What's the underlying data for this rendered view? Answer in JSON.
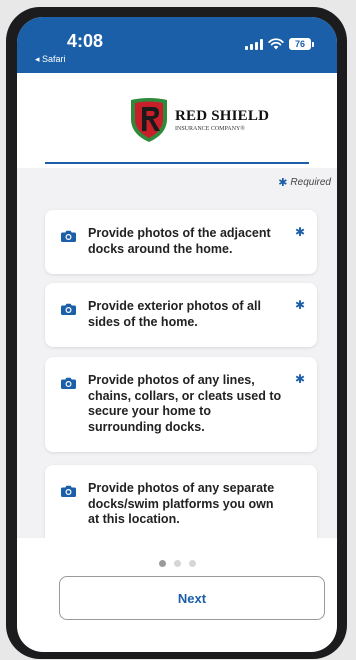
{
  "status_bar": {
    "time": "4:08",
    "back_app": "◂ Safari",
    "battery": "76"
  },
  "logo": {
    "name": "RED SHIELD",
    "subtitle": "INSURANCE COMPANY®",
    "mark_letter": "R"
  },
  "required_label": "Required",
  "cards": [
    {
      "text": "Provide photos of the adjacent docks around the home.",
      "required": true
    },
    {
      "text": "Provide exterior photos of all sides of the home.",
      "required": true
    },
    {
      "text": "Provide photos of any lines, chains, collars, or cleats used to secure your home to surrounding docks.",
      "required": true
    },
    {
      "text": "Provide photos of any separate docks/swim platforms you own at this location.",
      "required": false
    }
  ],
  "pagination": {
    "pages": 3,
    "current": 1
  },
  "next_label": "Next",
  "colors": {
    "accent": "#1b5fa8",
    "shield_red": "#c8202b",
    "shield_green": "#2f8a3c"
  },
  "icons": {
    "card_icon": "camera-icon",
    "required_icon": "asterisk-icon"
  }
}
